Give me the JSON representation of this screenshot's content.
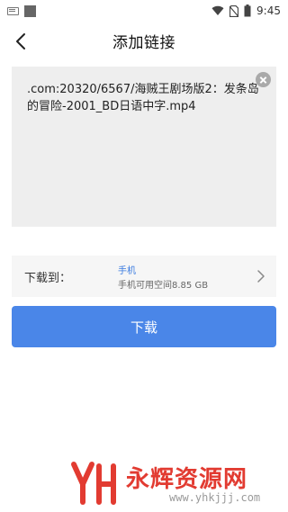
{
  "status_bar": {
    "time": "9:45",
    "icons": [
      "keyboard-icon",
      "square-icon",
      "wifi-icon",
      "no-sim-icon",
      "battery-icon"
    ]
  },
  "header": {
    "title": "添加链接",
    "back_icon": "chevron-left-icon"
  },
  "link_input": {
    "value": ".com:20320/6567/海贼王剧场版2：发条岛的冒险-2001_BD日语中字.mp4",
    "clear_icon": "clear-icon"
  },
  "destination": {
    "label": "下载到：",
    "name": "手机",
    "space": "手机可用空间8.85 GB",
    "chevron_icon": "chevron-right-icon"
  },
  "actions": {
    "download_label": "下载"
  },
  "watermark": {
    "name": "永辉资源网",
    "url": "www.yhkjjj.com"
  },
  "colors": {
    "accent": "#4a86e8",
    "link_blue": "#3a7be0",
    "input_bg": "#eeeeee",
    "row_bg": "#f6f6f6",
    "watermark_red": "#e23b31"
  }
}
